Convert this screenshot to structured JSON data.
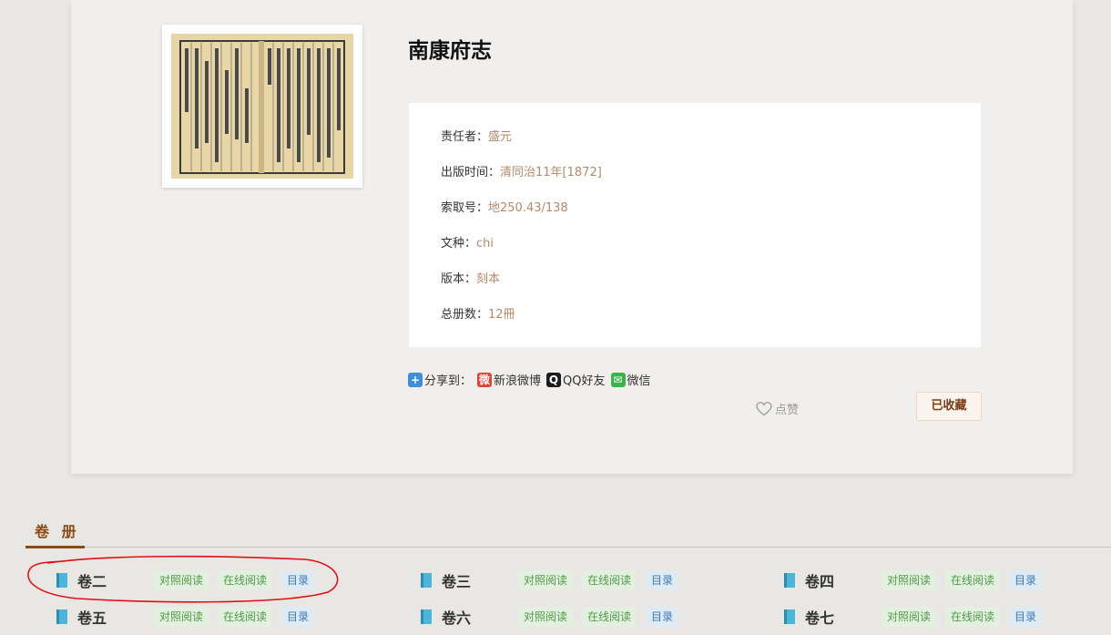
{
  "book": {
    "title": "南康府志",
    "meta": [
      {
        "label": "责任者：",
        "value": "盛元"
      },
      {
        "label": "出版时间：",
        "value": "清同治11年[1872]"
      },
      {
        "label": "索取号：",
        "value": "地250.43/138"
      },
      {
        "label": "文种：",
        "value": "chi"
      },
      {
        "label": "版本：",
        "value": "刻本"
      },
      {
        "label": "总册数：",
        "value": "12冊"
      }
    ]
  },
  "share": {
    "label": "分享到：",
    "weibo": "新浪微博",
    "qq": "QQ好友",
    "wechat": "微信"
  },
  "actions": {
    "like": "点赞",
    "favorite": "已收藏"
  },
  "volumes": {
    "heading": "卷 册",
    "items": [
      {
        "name": "卷二",
        "compare": "对照阅读",
        "online": "在线阅读",
        "toc": "目录"
      },
      {
        "name": "卷三",
        "compare": "对照阅读",
        "online": "在线阅读",
        "toc": "目录"
      },
      {
        "name": "卷四",
        "compare": "对照阅读",
        "online": "在线阅读",
        "toc": "目录"
      },
      {
        "name": "卷五",
        "compare": "对照阅读",
        "online": "在线阅读",
        "toc": "目录"
      },
      {
        "name": "卷六",
        "compare": "对照阅读",
        "online": "在线阅读",
        "toc": "目录"
      },
      {
        "name": "卷七",
        "compare": "对照阅读",
        "online": "在线阅读",
        "toc": "目录"
      }
    ]
  },
  "colors": {
    "accent": "#8b4a14",
    "meta_value": "#b4886a",
    "annotation": "#e01010"
  }
}
